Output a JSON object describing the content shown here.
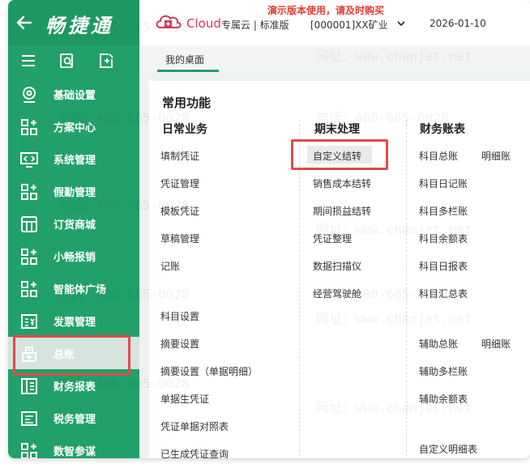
{
  "brand": {
    "name": "畅捷通"
  },
  "header": {
    "cloud_logo_text": "Cloud",
    "edition": "专属云 | 标准版",
    "company": "[000001]XX矿业",
    "date": "2026-01-10",
    "demo_warning": "演示版本使用，请及时购买"
  },
  "sidebar": {
    "items": [
      {
        "label": "基础设置",
        "icon": "gear-icon"
      },
      {
        "label": "方案中心",
        "icon": "grid-plus-icon"
      },
      {
        "label": "系统管理",
        "icon": "monitor-code-icon"
      },
      {
        "label": "假勤管理",
        "icon": "grid-plus-icon"
      },
      {
        "label": "订货商城",
        "icon": "store-icon"
      },
      {
        "label": "小畅报销",
        "icon": "grid-plus-icon"
      },
      {
        "label": "智能体广场",
        "icon": "grid-plus-icon"
      },
      {
        "label": "发票管理",
        "icon": "invoice-icon"
      },
      {
        "label": "总账",
        "icon": "ledger-icon",
        "active": true
      },
      {
        "label": "财务报表",
        "icon": "report-icon"
      },
      {
        "label": "税务管理",
        "icon": "tax-icon"
      },
      {
        "label": "数智参谋",
        "icon": "grid-plus-icon"
      }
    ]
  },
  "tabs": {
    "desktop": "我的桌面"
  },
  "card": {
    "title": "常用功能",
    "columns": {
      "daily": {
        "header": "日常业务",
        "items": [
          "填制凭证",
          "凭证管理",
          "模板凭证",
          "草稿管理",
          "记账",
          "科目设置",
          "摘要设置",
          "摘要设置（单据明细）",
          "单据生凭证",
          "凭证单据对照表",
          "已生成凭证查询"
        ]
      },
      "period_end": {
        "header": "期末处理",
        "items": [
          "自定义结转",
          "销售成本结转",
          "期间损益结转",
          "凭证整理",
          "数据扫描仪",
          "经营驾驶舱"
        ]
      },
      "books": {
        "header": "财务账表",
        "items": [
          "科目总账",
          "明细账",
          "科目日记账",
          "科目多栏账",
          "科目余额表",
          "科目日报表",
          "科目汇总表",
          "辅助总账",
          "明细账",
          "辅助多栏账",
          "辅助余额表",
          "自定义明细表"
        ]
      }
    }
  },
  "watermark": {
    "phone": "电话：400-665-0028",
    "site": "网址：www.chanjet.net"
  },
  "colors": {
    "sidebar": "#21a06a",
    "accent": "#21a06a",
    "highlight": "#e24a4a",
    "warning": "#e53a2f"
  }
}
